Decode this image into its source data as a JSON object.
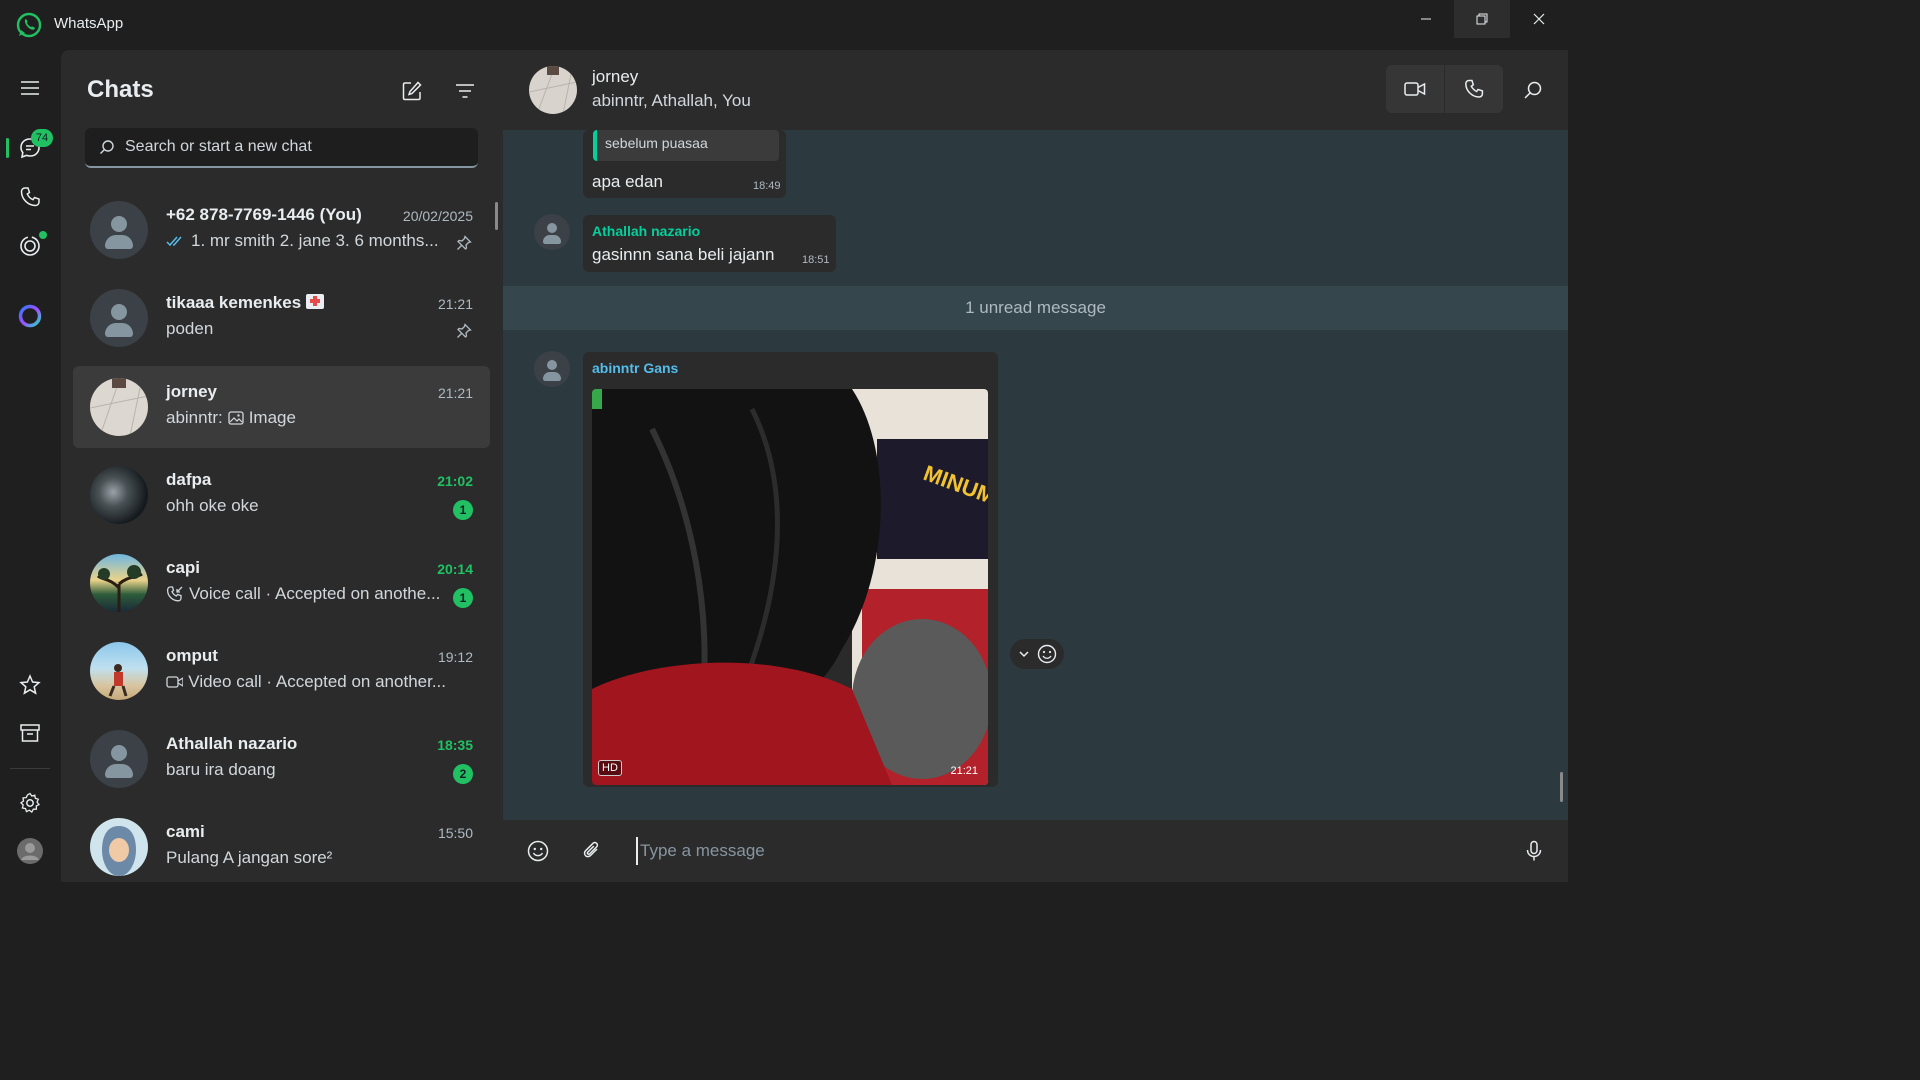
{
  "app": {
    "title": "WhatsApp"
  },
  "rail": {
    "chats_badge": "74"
  },
  "chatlist": {
    "title": "Chats",
    "search_placeholder": "Search or start a new chat",
    "items": [
      {
        "name": "+62 878-7769-1446 (You)",
        "time": "20/02/2025",
        "preview": "1. mr smith 2. jane 3. 6 months...",
        "pinned": true,
        "read_ticks": true
      },
      {
        "name": "tikaaa kemenkes",
        "time": "21:21",
        "preview": "poden",
        "pinned": true
      },
      {
        "name": "jorney",
        "time": "21:21",
        "preview_sender": "abinntr:",
        "preview": "Image",
        "active": true
      },
      {
        "name": "dafpa",
        "time": "21:02",
        "preview": "ohh oke oke",
        "unread": "1"
      },
      {
        "name": "capi",
        "time": "20:14",
        "preview": "Voice call · Accepted on anothe...",
        "unread": "1"
      },
      {
        "name": "omput",
        "time": "19:12",
        "preview": "Video call · Accepted on another..."
      },
      {
        "name": "Athallah nazario",
        "time": "18:35",
        "preview": "baru ira doang",
        "unread": "2"
      },
      {
        "name": "cami",
        "time": "15:50",
        "preview": "Pulang A jangan sore²"
      }
    ]
  },
  "conversation": {
    "name": "jorney",
    "members": "abinntr, Athallah, You",
    "messages": [
      {
        "quote": "sebelum puasaa",
        "text": "apa edan",
        "time": "18:49"
      },
      {
        "sender": "Athallah nazario",
        "text": "gasinnn sana beli jajann",
        "time": "18:51"
      },
      {
        "sender": "abinntr Gans",
        "hd": "HD",
        "time": "21:21"
      }
    ],
    "unread_divider": "1 unread message"
  },
  "composer": {
    "placeholder": "Type a message"
  },
  "colors": {
    "accent": "#21c063",
    "athallah": "#06cf9c",
    "abinntr": "#53bdeb"
  }
}
